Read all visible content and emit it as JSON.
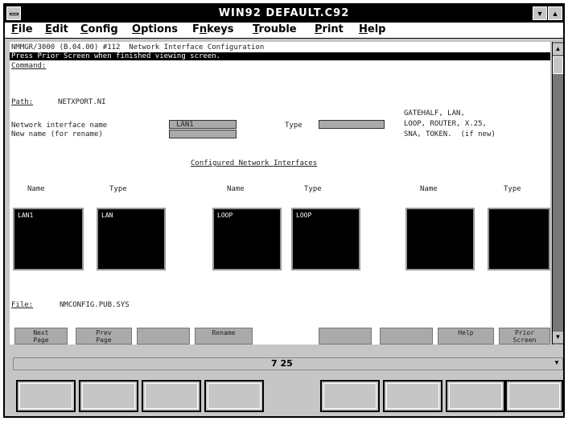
{
  "window": {
    "title": "WIN92 DEFAULT.C92"
  },
  "menu": [
    {
      "label": "File",
      "key": "F",
      "rest": "ile"
    },
    {
      "label": "Edit",
      "key": "E",
      "rest": "dit"
    },
    {
      "label": "Config",
      "key": "C",
      "rest": "onfig"
    },
    {
      "label": "Options",
      "key": "O",
      "rest": "ptions"
    },
    {
      "label": "Fnkeys",
      "key": "n",
      "pre": "F",
      "rest": "keys"
    },
    {
      "label": "Trouble",
      "key": "T",
      "rest": "rouble"
    },
    {
      "label": "Print",
      "key": "P",
      "rest": "rint"
    },
    {
      "label": "Help",
      "key": "H",
      "rest": "elp"
    }
  ],
  "terminal": {
    "header": "NMMGR/3000 (B.04.00) #112  Network Interface Configuration",
    "prompt": "Press Prior Screen when finished viewing screen.",
    "command_label": "Command:",
    "path_label": "Path:",
    "path_value": "NETXPORT.NI",
    "ni_name_label": "Network interface name",
    "ni_name_value": "LAN1",
    "new_name_label": "New name (for rename)",
    "type_label": "Type",
    "types_hint_1": "GATEHALF, LAN,",
    "types_hint_2": "LOOP, ROUTER, X.25,",
    "types_hint_3": "SNA, TOKEN.  (if new)",
    "configured_heading": "Configured Network Interfaces",
    "col_name": "Name",
    "col_type": "Type",
    "panes": [
      {
        "name": "LAN1",
        "type": "LAN"
      },
      {
        "name": "LOOP",
        "type": "LOOP"
      },
      {
        "name": "",
        "type": ""
      }
    ],
    "file_label": "File:",
    "file_value": "NMCONFIG.PUB.SYS",
    "fkeys": {
      "next": "Next\nPage",
      "prev": "Prev\nPage",
      "rename": "Rename",
      "help": "Help",
      "prior": "Prior\nScreen"
    }
  },
  "status": {
    "position": "7  25"
  }
}
